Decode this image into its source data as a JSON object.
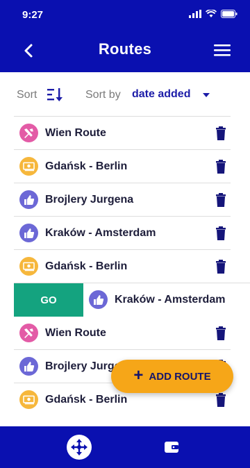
{
  "status": {
    "time": "9:27"
  },
  "header": {
    "title": "Routes"
  },
  "sort": {
    "label": "Sort",
    "by_label": "Sort by",
    "value": "date added"
  },
  "routes": [
    {
      "name": "Wien Route",
      "icon": "tools-icon"
    },
    {
      "name": "Gdańsk - Berlin",
      "icon": "money-icon"
    },
    {
      "name": "Brojlery Jurgena",
      "icon": "thumbs-up-icon"
    },
    {
      "name": "Kraków - Amsterdam",
      "icon": "thumbs-up-icon"
    },
    {
      "name": "Gdańsk - Berlin",
      "icon": "money-icon"
    },
    {
      "name": "Kraków - Amsterdam",
      "icon": "thumbs-up-icon",
      "swiped": true,
      "action_label": "GO"
    },
    {
      "name": "Wien Route",
      "icon": "tools-icon"
    },
    {
      "name": "Brojlery Jurgena",
      "icon": "thumbs-up-icon"
    },
    {
      "name": "Gdańsk - Berlin",
      "icon": "money-icon"
    }
  ],
  "fab": {
    "label": "ADD ROUTE"
  },
  "colors": {
    "primary": "#0a10b0",
    "go": "#14a37f",
    "fab": "#f6a618",
    "tools": "#e35ba6",
    "money": "#f6b73c",
    "like": "#6c68d6"
  }
}
